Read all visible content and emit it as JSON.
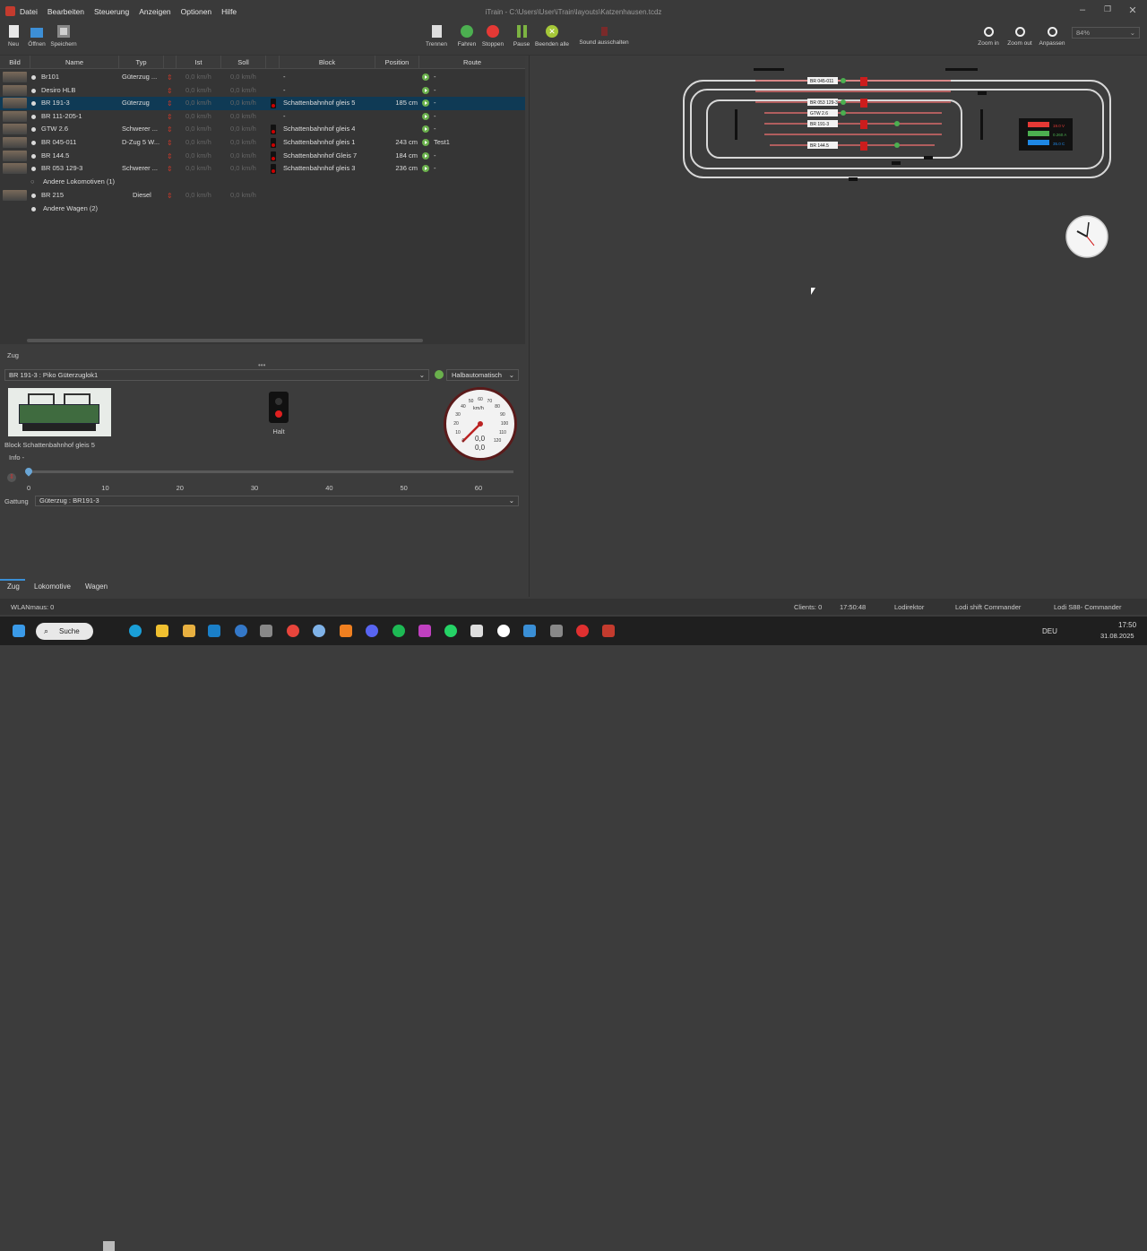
{
  "app": {
    "title": "iTrain - C:\\Users\\User\\iTrain\\layouts\\Katzenhausen.tcdz"
  },
  "menu": [
    "Datei",
    "Bearbeiten",
    "Steuerung",
    "Anzeigen",
    "Optionen",
    "Hilfe"
  ],
  "toolbar": {
    "neu": "Neu",
    "oeffnen": "Öffnen",
    "speichern": "Speichern",
    "trennen": "Trennen",
    "fahren": "Fahren",
    "stoppen": "Stoppen",
    "pause": "Pause",
    "beenden": "Beenden alle",
    "sound": "Sound ausschalten",
    "zoom_in": "Zoom in",
    "zoom_out": "Zoom out",
    "anpassen": "Anpassen",
    "zoom_value": "84%"
  },
  "table": {
    "columns": [
      "Bild",
      "Name",
      "Typ",
      "",
      "Ist",
      "Soll",
      "",
      "Block",
      "Position",
      "Route"
    ],
    "rows": [
      {
        "name": "Br101",
        "typ": "Güterzug ...",
        "ist": "0,0 km/h",
        "soll": "0,0 km/h",
        "block": "-",
        "pos": "",
        "route": "-"
      },
      {
        "name": "Desiro HLB",
        "typ": "",
        "ist": "0,0 km/h",
        "soll": "0,0 km/h",
        "block": "-",
        "pos": "",
        "route": "-"
      },
      {
        "name": "BR 191-3",
        "typ": "Güterzug",
        "ist": "0,0 km/h",
        "soll": "0,0 km/h",
        "block": "Schattenbahnhof gleis 5",
        "pos": "185 cm",
        "route": "-"
      },
      {
        "name": "BR 111-205-1",
        "typ": "",
        "ist": "0,0 km/h",
        "soll": "0,0 km/h",
        "block": "-",
        "pos": "",
        "route": "-"
      },
      {
        "name": "GTW 2.6",
        "typ": "Schwerer ...",
        "ist": "0,0 km/h",
        "soll": "0,0 km/h",
        "block": "Schattenbahnhof gleis 4",
        "pos": "",
        "route": "-"
      },
      {
        "name": "BR 045-011",
        "typ": "D-Zug 5 W...",
        "ist": "0,0 km/h",
        "soll": "0,0 km/h",
        "block": "Schattenbahnhof gleis 1",
        "pos": "243 cm",
        "route": "Test1"
      },
      {
        "name": "BR 144.5",
        "typ": "",
        "ist": "0,0 km/h",
        "soll": "0,0 km/h",
        "block": "Schattenbahnhof Gleis 7",
        "pos": "184 cm",
        "route": "-"
      },
      {
        "name": "BR 053 129-3",
        "typ": "Schwerer ...",
        "ist": "0,0 km/h",
        "soll": "0,0 km/h",
        "block": "Schattenbahnhof gleis 3",
        "pos": "236 cm",
        "route": "-"
      }
    ],
    "andere_loks": "Andere Lokomotiven (1)",
    "br215": {
      "name": "BR 215",
      "typ": "Diesel",
      "ist": "0,0 km/h",
      "soll": "0,0 km/h"
    },
    "andere_wagen": "Andere Wagen (2)"
  },
  "zug": {
    "section": "Zug",
    "selected": "BR 191-3 : Piko Güterzuglok1",
    "mode": "Halbautomatisch",
    "signal": "Halt",
    "block": "Block  Schattenbahnhof gleis 5",
    "info": "Info  -",
    "scale": [
      "0",
      "10",
      "20",
      "30",
      "40",
      "50",
      "60"
    ],
    "speed_unit": "km/h",
    "speed1": "0,0",
    "speed2": "0,0",
    "gauge": [
      "0",
      "10",
      "20",
      "30",
      "40",
      "50",
      "60",
      "70",
      "80",
      "90",
      "100",
      "110",
      "120"
    ],
    "gattung_label": "Gattung",
    "gattung": "Güterzug : BR191-3"
  },
  "tabs": [
    "Zug",
    "Lokomotive",
    "Wagen"
  ],
  "status": {
    "wlan": "WLANmaus: 0",
    "clients": "Clients: 0",
    "time": "17:50:48",
    "c1": "Lodirektor",
    "c2": "Lodi shift Commander",
    "c3": "Lodi S88- Commander"
  },
  "plan": {
    "labels": [
      "BR 045-011",
      "BR 053 129-3",
      "GTW 2.6",
      "BR 191-3",
      "BR 144.5"
    ],
    "meter": [
      "19.0 V",
      "0.260 A",
      "35.0 C"
    ]
  },
  "taskbar": {
    "search": "Suche",
    "lang": "DEU",
    "time": "17:50",
    "date": "31.08.2025"
  }
}
